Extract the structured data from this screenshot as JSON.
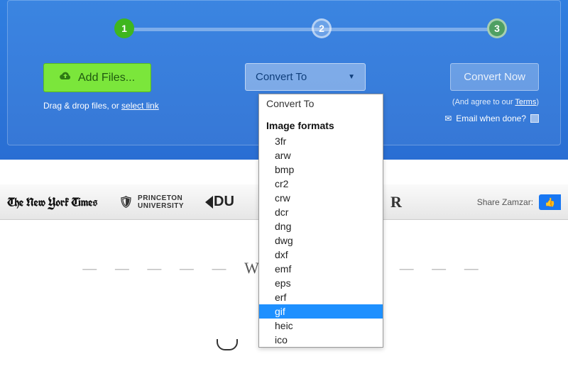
{
  "steps": {
    "s1": "1",
    "s2": "2",
    "s3": "3"
  },
  "addFiles": {
    "label": "Add Files..."
  },
  "dropText": {
    "prefix": "Drag & drop files, or ",
    "link": "select link"
  },
  "convertSelect": {
    "label": "Convert To"
  },
  "convertNow": {
    "label": "Convert Now"
  },
  "terms": {
    "prefix": "(And agree to our ",
    "link": "Terms",
    "suffix": ")"
  },
  "emailDone": {
    "label": "Email when done?"
  },
  "logos": {
    "nyt": "The New York Times",
    "princeton_top": "PRINCETON",
    "princeton_bottom": "UNIVERSITY",
    "du": "DU",
    "r": "R"
  },
  "share": {
    "label": "Share Zamzar:"
  },
  "dashes": {
    "left": "— — — — —",
    "w": "W",
    "right": "— — — — — — —"
  },
  "dropdown": {
    "header": "Convert To",
    "group": "Image formats",
    "items": [
      "3fr",
      "arw",
      "bmp",
      "cr2",
      "crw",
      "dcr",
      "dng",
      "dwg",
      "dxf",
      "emf",
      "eps",
      "erf",
      "gif",
      "heic",
      "ico"
    ],
    "highlighted": "gif"
  }
}
